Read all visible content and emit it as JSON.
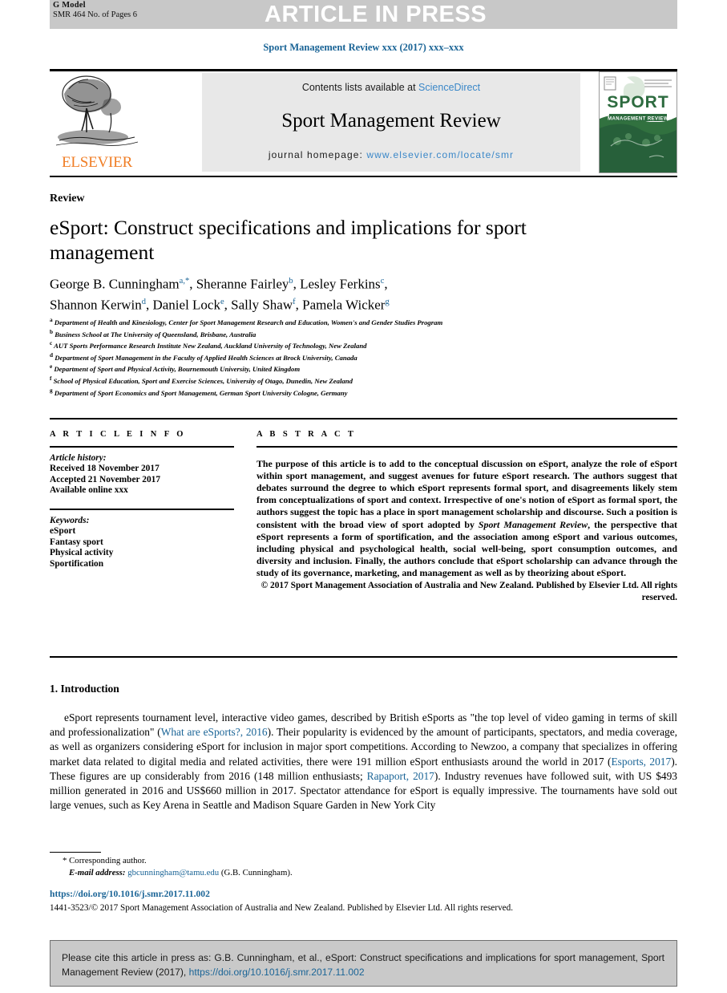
{
  "banner": {
    "g_model": "G Model",
    "model_id": "SMR 464 No. of Pages 6",
    "article_in_press": "ARTICLE IN PRESS"
  },
  "journal_ref": "Sport Management Review xxx (2017) xxx–xxx",
  "masthead": {
    "contents_prefix": "Contents lists available at ",
    "sciencedirect": "ScienceDirect",
    "journal_title": "Sport Management Review",
    "homepage_label": "journal homepage: ",
    "homepage_url": "www.elsevier.com/locate/smr",
    "publisher": "ELSEVIER",
    "cover_title": "SPORT",
    "cover_subtitle": "MANAGEMENT REVIEW"
  },
  "article": {
    "section_type": "Review",
    "title": "eSport: Construct specifications and implications for sport management",
    "authors": [
      {
        "name": "George B. Cunningham",
        "marks": "a,*"
      },
      {
        "name": "Sheranne Fairley",
        "marks": "b"
      },
      {
        "name": "Lesley Ferkins",
        "marks": "c"
      },
      {
        "name": "Shannon Kerwin",
        "marks": "d"
      },
      {
        "name": "Daniel Lock",
        "marks": "e"
      },
      {
        "name": "Sally Shaw",
        "marks": "f"
      },
      {
        "name": "Pamela Wicker",
        "marks": "g"
      }
    ],
    "affiliations": [
      {
        "mark": "a",
        "text": "Department of Health and Kinesiology, Center for Sport Management Research and Education, Women's and Gender Studies Program"
      },
      {
        "mark": "b",
        "text": "Business School at The University of Queensland, Brisbane, Australia"
      },
      {
        "mark": "c",
        "text": "AUT Sports Performance Research Institute New Zealand, Auckland University of Technology, New Zealand"
      },
      {
        "mark": "d",
        "text": "Department of Sport Management in the Faculty of Applied Health Sciences at Brock University, Canada"
      },
      {
        "mark": "e",
        "text": "Department of Sport and Physical Activity, Bournemouth University, United Kingdom"
      },
      {
        "mark": "f",
        "text": "School of Physical Education, Sport and Exercise Sciences, University of Otago, Dunedin, New Zealand"
      },
      {
        "mark": "g",
        "text": "Department of Sport Economics and Sport Management, German Sport University Cologne, Germany"
      }
    ]
  },
  "article_info": {
    "heading": "A R T I C L E  I N F O",
    "history_label": "Article history:",
    "history": [
      "Received 18 November 2017",
      "Accepted 21 November 2017",
      "Available online xxx"
    ],
    "keywords_label": "Keywords:",
    "keywords": [
      "eSport",
      "Fantasy sport",
      "Physical activity",
      "Sportification"
    ]
  },
  "abstract": {
    "heading": "A B S T R A C T",
    "p1_a": "The purpose of this article is to add to the conceptual discussion on eSport, analyze the role of eSport within sport management, and suggest avenues for future eSport research. The authors suggest that debates surround the degree to which eSport represents formal sport, and disagreements likely stem from conceptualizations of sport and context. Irrespective of one's notion of eSport as formal sport, the authors suggest the topic has a place in sport management scholarship and discourse. Such a position is consistent with the broad view of sport adopted by ",
    "p1_italic": "Sport Management Review",
    "p1_b": ", the perspective that eSport represents a form of sportification, and the association among eSport and various outcomes, including physical and psychological health, social well-being, sport consumption outcomes, and diversity and inclusion. Finally, the authors conclude that eSport scholarship can advance through the study of its governance, marketing, and management as well as by theorizing about eSport.",
    "copyright": "© 2017 Sport Management Association of Australia and New Zealand. Published by Elsevier Ltd. All rights reserved."
  },
  "body": {
    "section_heading": "1. Introduction",
    "p1_a": "eSport represents tournament level, interactive video games, described by British eSports as \"the top level of video gaming in terms of skill and professionalization\" (",
    "cite1": "What are eSports?, 2016",
    "p1_b": "). Their popularity is evidenced by the amount of participants, spectators, and media coverage, as well as organizers considering eSport for inclusion in major sport competitions. According to Newzoo, a company that specializes in offering market data related to digital media and related activities, there were 191 million eSport enthusiasts around the world in 2017 (",
    "cite2": "Esports, 2017",
    "p1_c": "). These figures are up considerably from 2016 (148 million enthusiasts; ",
    "cite3": "Rapaport, 2017",
    "p1_d": "). Industry revenues have followed suit, with US $493 million generated in 2016 and US$660 million in 2017. Spectator attendance for eSport is equally impressive. The tournaments have sold out large venues, such as Key Arena in Seattle and Madison Square Garden in New York City"
  },
  "footnotes": {
    "corresponding": "* Corresponding author.",
    "email_label": "E-mail address:",
    "email": "gbcunningham@tamu.edu",
    "email_suffix": "(G.B. Cunningham).",
    "doi": "https://doi.org/10.1016/j.smr.2017.11.002",
    "issn_line": "1441-3523/© 2017 Sport Management Association of Australia and New Zealand. Published by Elsevier Ltd. All rights reserved."
  },
  "cite_box": {
    "text_a": "Please cite this article in press as: G.B. Cunningham, et al., eSport: Construct specifications and implications for sport management, Sport Management Review (2017), ",
    "link": "https://doi.org/10.1016/j.smr.2017.11.002"
  },
  "colors": {
    "link": "#1a6496",
    "elsevier_orange": "#f07e26",
    "banner_grey": "#c8c8c8",
    "masthead_grey": "#e8e8e8",
    "cite_box_grey": "#c9c9c9",
    "cover_green": "#2d6b3f"
  }
}
